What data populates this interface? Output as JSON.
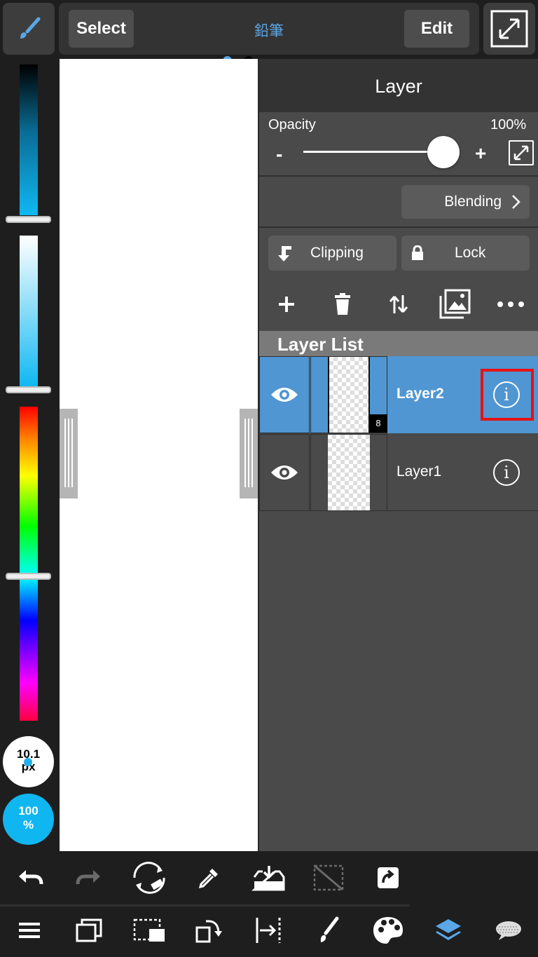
{
  "toolbar": {
    "select_label": "Select",
    "brush_name": "鉛筆",
    "edit_label": "Edit"
  },
  "left_panel": {
    "brush_size": "10.1",
    "brush_size_unit": "px",
    "brush_opacity": "100",
    "brush_opacity_unit": "%"
  },
  "layer_panel": {
    "title": "Layer",
    "opacity_label": "Opacity",
    "opacity_value": "100%",
    "opacity_fraction": 1.0,
    "minus_label": "-",
    "plus_label": "+",
    "blending_label": "Blending",
    "clipping_label": "Clipping",
    "lock_label": "Lock",
    "list_header": "Layer List",
    "layers": [
      {
        "name": "Layer2",
        "selected": true,
        "badge": "8"
      },
      {
        "name": "Layer1",
        "selected": false
      }
    ]
  },
  "colors": {
    "accent": "#5aa6e6",
    "selected_row": "#4f96d2",
    "highlight": "#e61212",
    "size_dot": "#22b0ea",
    "opacity_circle": "#10b6f0"
  },
  "icons": {
    "top": [
      "brush-icon",
      "fullscreen-icon"
    ],
    "layer_actions": [
      "add-icon",
      "trash-icon",
      "move-layer-icon",
      "import-image-icon",
      "more-icon"
    ],
    "bottom_row1": [
      "undo-icon",
      "redo-icon",
      "transform-eraser-icon",
      "eyedropper-icon",
      "import-icon",
      "deselect-icon",
      "share-icon"
    ],
    "bottom_row2": [
      "menu-icon",
      "layers-window-icon",
      "selection-icon",
      "rotate-icon",
      "ruler-icon",
      "brush-icon",
      "palette-icon",
      "layers-icon",
      "chat-icon"
    ]
  }
}
